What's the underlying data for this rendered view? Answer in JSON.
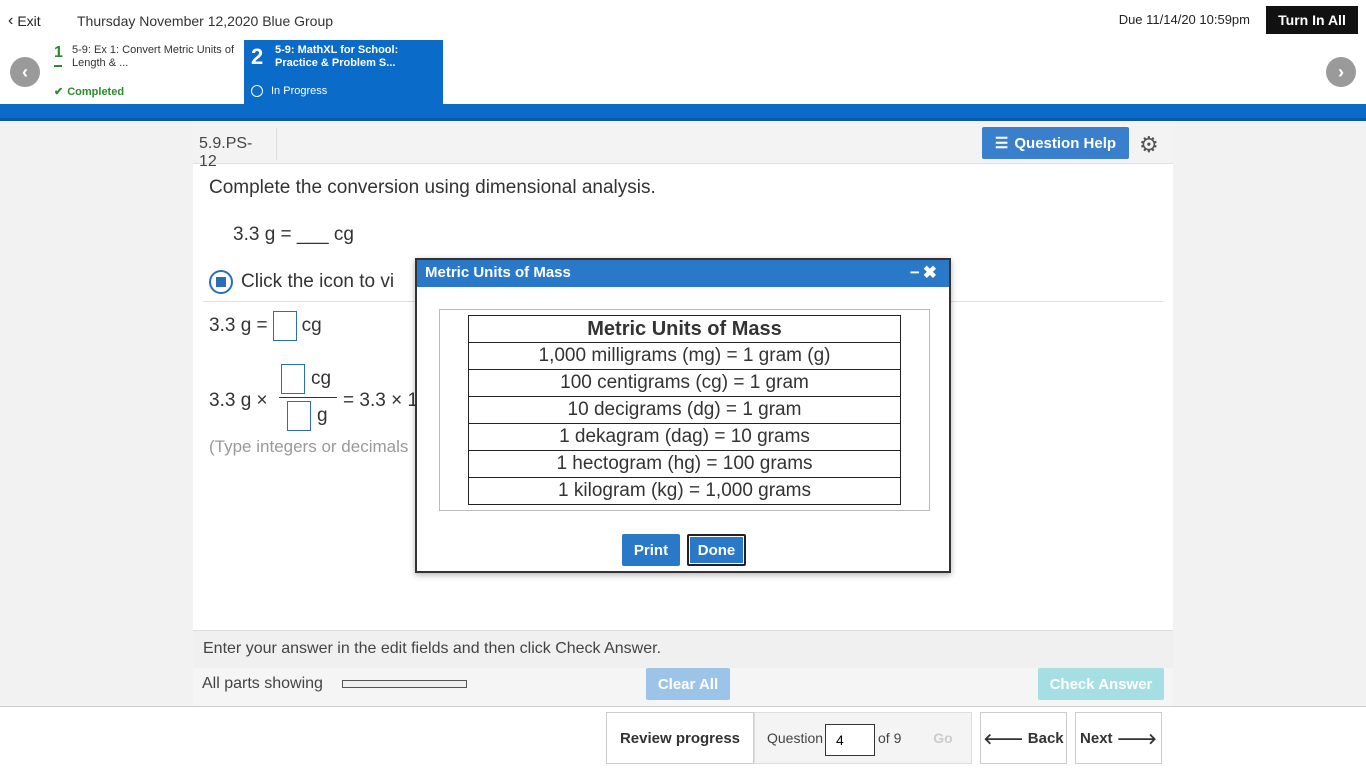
{
  "header": {
    "exit_label": "Exit",
    "assignment_title": "Thursday November 12,2020 Blue Group",
    "due": "Due 11/14/20 10:59pm",
    "turn_in_label": "Turn In All"
  },
  "tasks": [
    {
      "number": "1",
      "name": "5-9: Ex 1: Convert Metric Units of Length & ...",
      "status": "Completed"
    },
    {
      "number": "2",
      "name": "5-9: MathXL for School: Practice & Problem S...",
      "status": "In Progress"
    }
  ],
  "question": {
    "id": "5.9.PS-12",
    "help_label": "Question Help",
    "instruction": "Complete the conversion using dimensional analysis.",
    "equation": "3.3 g = ___ cg",
    "click_text": "Click the icon to vi",
    "answer_lead": "3.3 g =",
    "answer_unit": "cg",
    "frac_lead": "3.3 g ×",
    "frac_num_unit": "cg",
    "frac_den_unit": "g",
    "frac_tail": "= 3.3 × 1",
    "type_hint": "(Type integers or decimals"
  },
  "bottom": {
    "enter_text": "Enter your answer in the edit fields and then click Check Answer.",
    "all_parts": "All parts showing",
    "progress": 0.0,
    "clear_all": "Clear All",
    "check_answer": "Check Answer"
  },
  "footer": {
    "review": "Review progress",
    "question_label": "Question",
    "question_value": "4",
    "of_total": "of 9",
    "go": "Go",
    "back": "Back",
    "next": "Next"
  },
  "modal": {
    "title": "Metric Units of Mass",
    "table_header": "Metric Units of Mass",
    "rows": [
      {
        "left": "1,000 milligrams (mg)",
        "right": "1 gram (g)"
      },
      {
        "left": "100 centigrams (cg)",
        "right": "1 gram"
      },
      {
        "left": "10 decigrams (dg)",
        "right": "1 gram"
      },
      {
        "left": "1 dekagram (dag)",
        "right": "10 grams"
      },
      {
        "left": "1 hectogram (hg)",
        "right": "100 grams"
      },
      {
        "left": "1 kilogram (kg)",
        "right": "1,000 grams"
      }
    ],
    "print_label": "Print",
    "done_label": "Done"
  },
  "colors": {
    "brand_blue": "#0a6bc8",
    "completed_green": "#2a8c2a"
  }
}
